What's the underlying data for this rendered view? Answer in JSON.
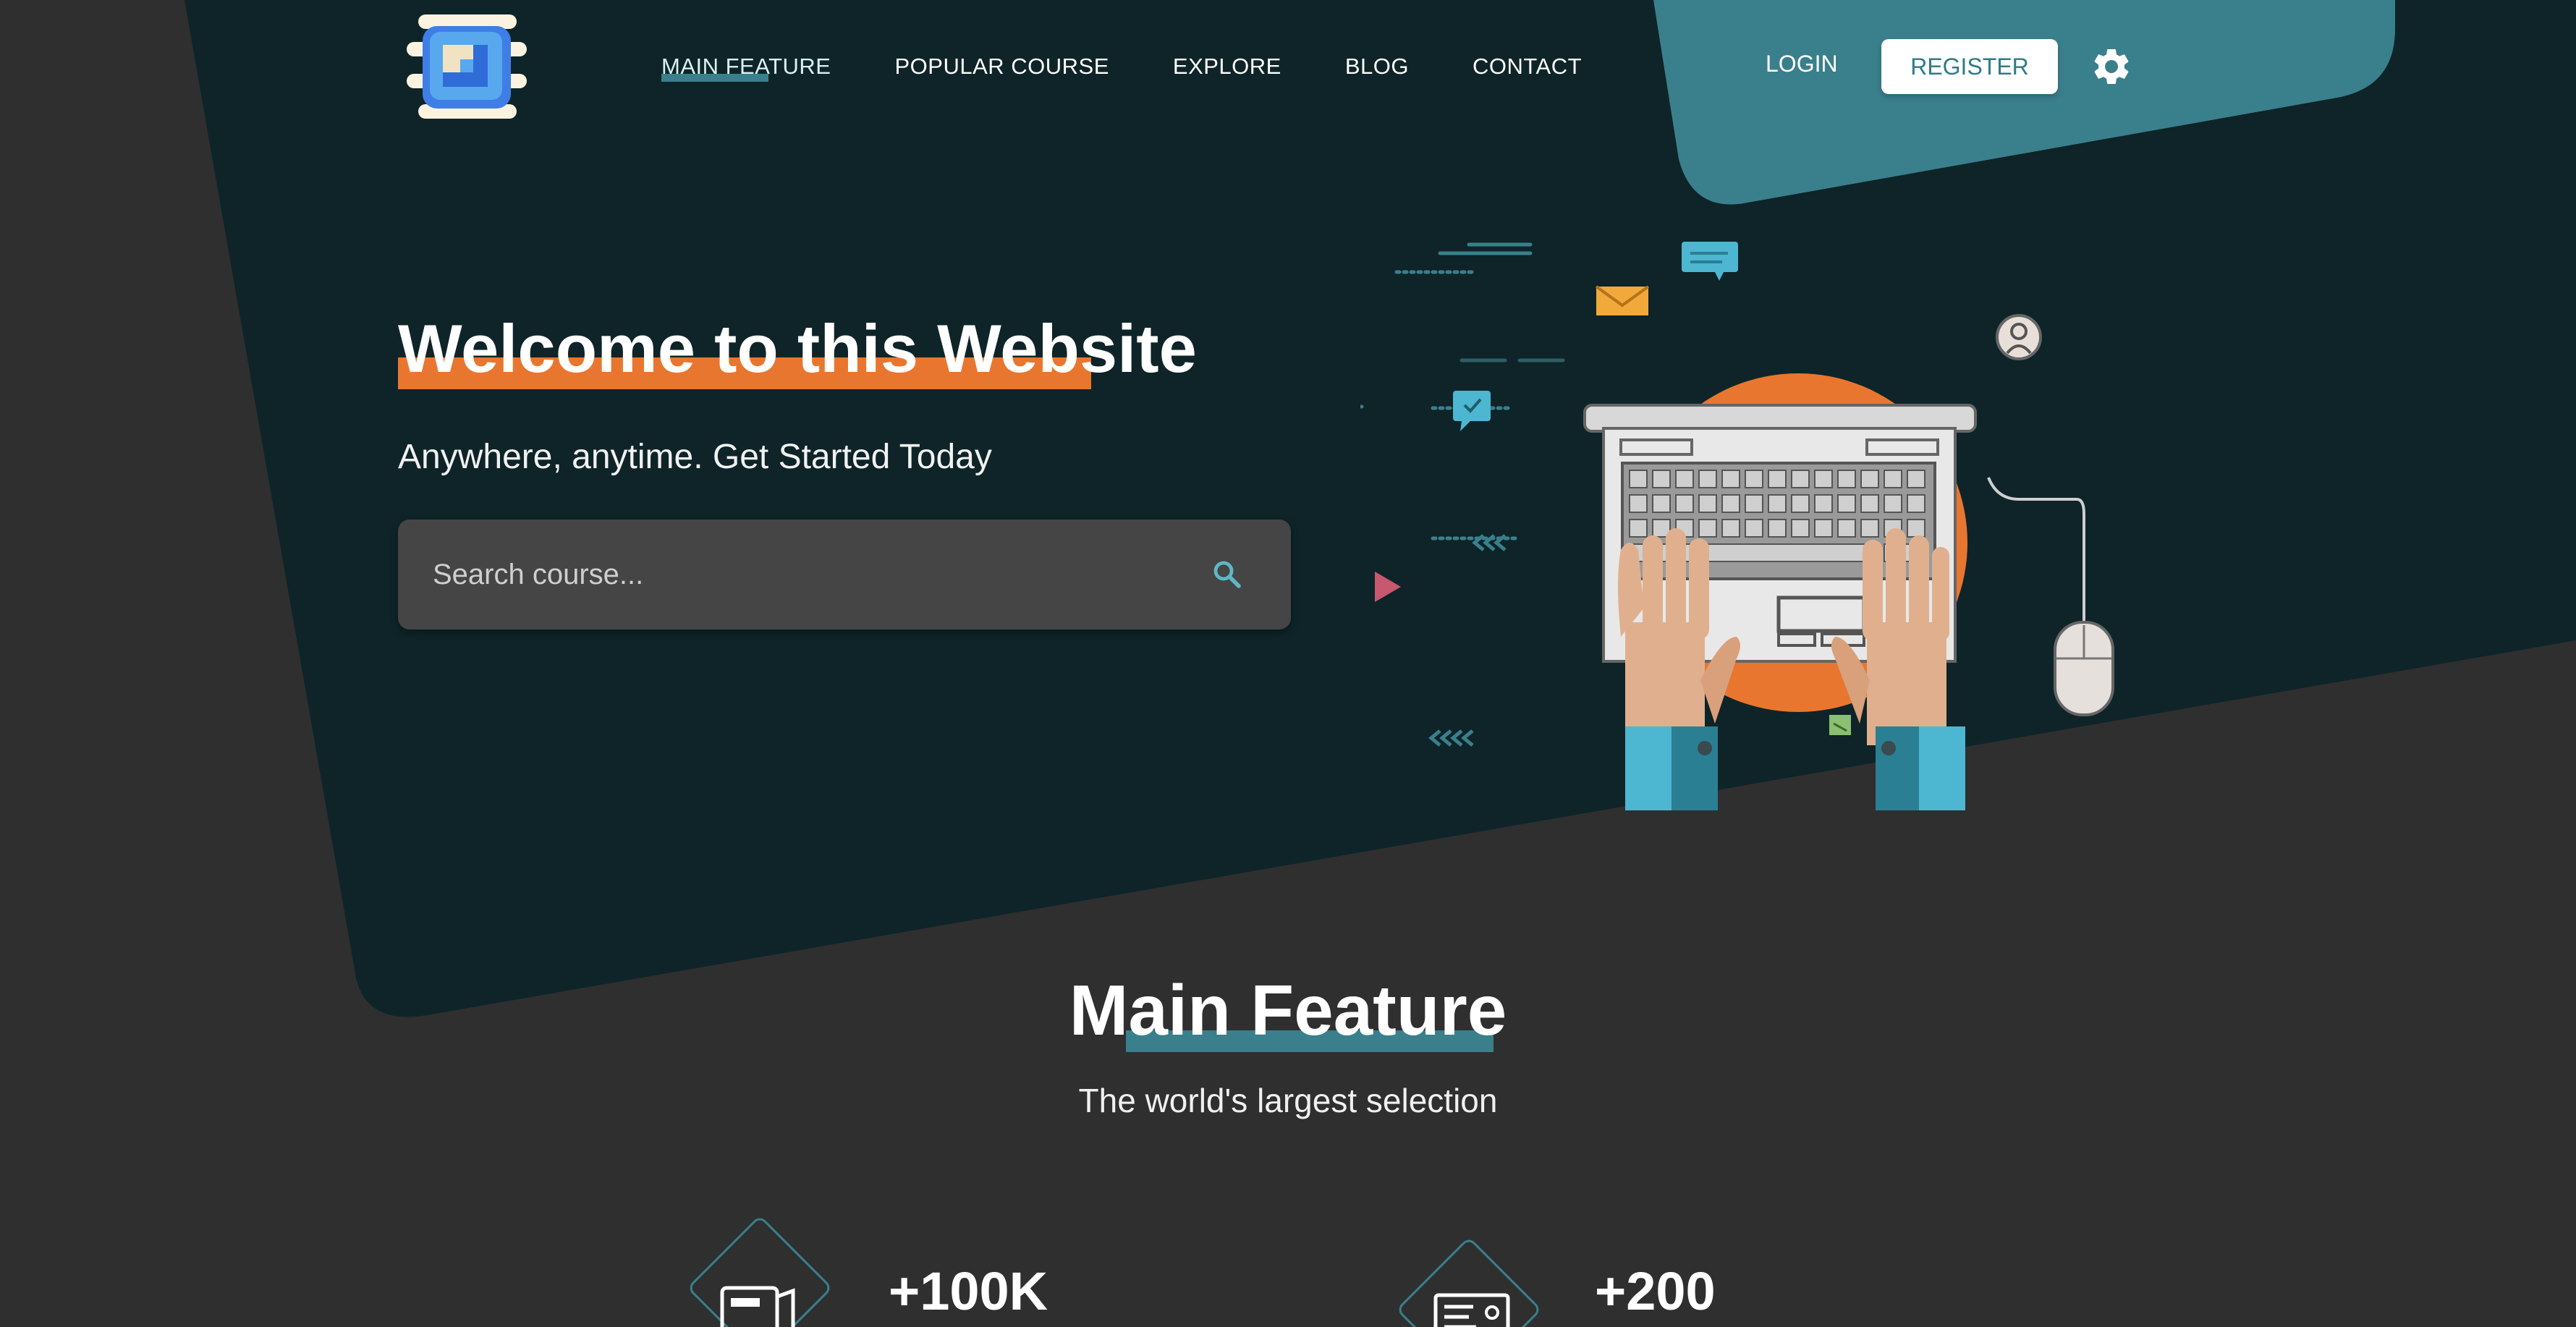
{
  "colors": {
    "page_background": "#2f2f2f",
    "hero_background": "#0e2428",
    "accent_teal": "#3a7f8c",
    "accent_orange": "#e9762f",
    "register_text": "#2f7b88"
  },
  "header": {
    "logo_icon": "layered-square-logo-icon",
    "nav": [
      {
        "label": "MAIN FEATURE",
        "active": true
      },
      {
        "label": "POPULAR COURSE",
        "active": false
      },
      {
        "label": "EXPLORE",
        "active": false
      },
      {
        "label": "BLOG",
        "active": false
      },
      {
        "label": "CONTACT",
        "active": false
      }
    ],
    "login_label": "LOGIN",
    "register_label": "REGISTER",
    "settings_icon": "gear-icon"
  },
  "hero": {
    "title": "Welcome to this Website",
    "subtitle": "Anywhere, anytime. Get Started Today",
    "search": {
      "placeholder": "Search course...",
      "value": "",
      "icon": "search-icon"
    },
    "illustration": "hands-typing-on-laptop-illustration"
  },
  "main_feature": {
    "title": "Main Feature",
    "subtitle": "The world's largest selection",
    "stats": [
      {
        "value": "+100K",
        "icon": "hd-video-icon"
      },
      {
        "value": "+200",
        "icon": "certificate-icon"
      }
    ]
  }
}
